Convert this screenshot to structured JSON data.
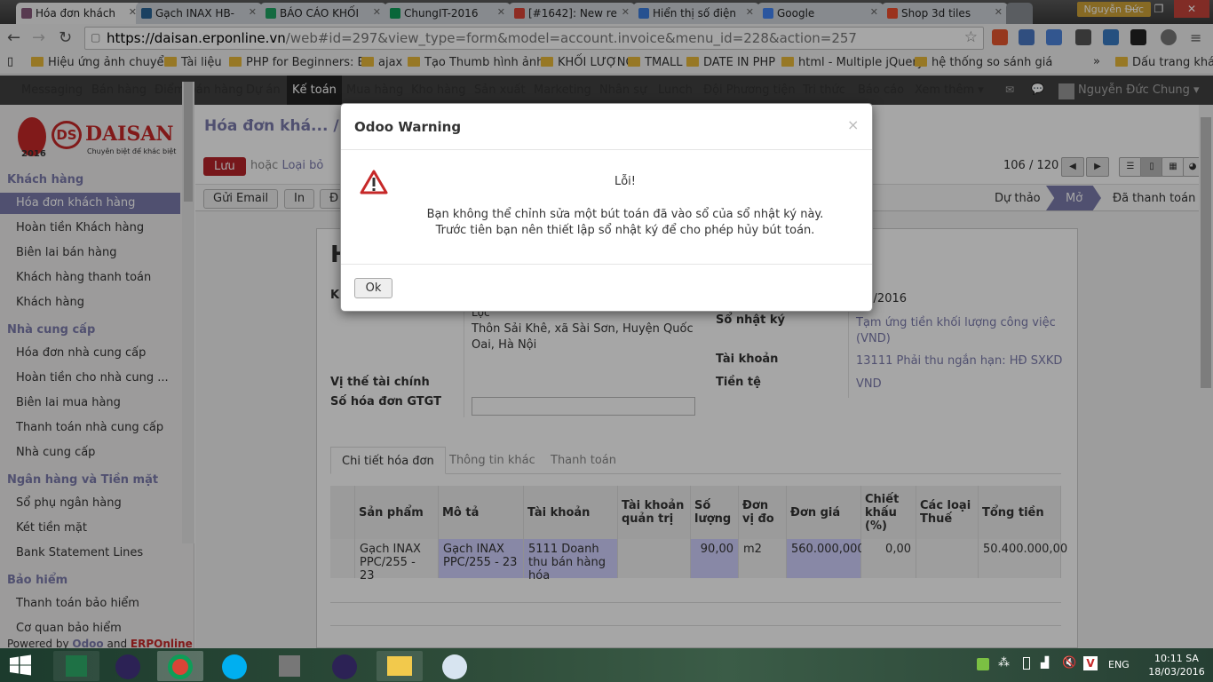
{
  "browser": {
    "tabs": [
      {
        "title": "Hóa đơn khách",
        "active": true,
        "color": "#875a7b"
      },
      {
        "title": "Gạch INAX HB-",
        "color": "#2a6496"
      },
      {
        "title": "BÁO CÁO KHỐI",
        "color": "#1fa463"
      },
      {
        "title": "ChungIT-2016",
        "color": "#0f9d58"
      },
      {
        "title": "[#1642]: New re",
        "color": "#db4437"
      },
      {
        "title": "Hiển thị số điện",
        "color": "#3b7ddd"
      },
      {
        "title": "Google",
        "color": "#4285f4"
      },
      {
        "title": "Shop 3d tiles",
        "color": "#ee4d2d"
      }
    ],
    "user": "Nguyễn Đức",
    "url_host": "https://daisan.erponline.vn",
    "url_rest": "/web#id=297&view_type=form&model=account.invoice&menu_id=228&action=257",
    "bookmarks": [
      "Hiệu ứng ảnh chuyển",
      "Tài liệu",
      "PHP for Beginners: Bu",
      "ajax",
      "Tạo Thumb hình ảnh",
      "KHỐI LƯỢNG",
      "TMALL",
      "DATE IN PHP",
      "html - Multiple jQuery",
      "hệ thống so sánh giá",
      "Dấu trang khác"
    ]
  },
  "topmenu": {
    "items": [
      "Messaging",
      "Bán hàng",
      "Điểm bán hàng",
      "Dự án",
      "Kế toán",
      "Mua hàng",
      "Kho hàng",
      "Sản xuất",
      "Marketing",
      "Nhân sự",
      "Lunch",
      "Đội Phương tiện",
      "Tri thức",
      "Báo cáo",
      "Xem thêm ▾"
    ],
    "active_index": 4,
    "user": "Nguyễn Đức Chung ▾"
  },
  "logo": {
    "name": "DAISAN",
    "slogan": "Chuyên biệt để khác biệt",
    "year": "2016"
  },
  "sidebar": {
    "sections": [
      {
        "title": "Khách hàng",
        "items": [
          "Hóa đơn khách hàng",
          "Hoàn tiền Khách hàng",
          "Biên lai bán hàng",
          "Khách hàng thanh toán",
          "Khách hàng"
        ]
      },
      {
        "title": "Nhà cung cấp",
        "items": [
          "Hóa đơn nhà cung cấp",
          "Hoàn tiền cho nhà cung ...",
          "Biên lai mua hàng",
          "Thanh toán nhà cung cấp",
          "Nhà cung cấp"
        ]
      },
      {
        "title": "Ngân hàng và Tiền mặt",
        "items": [
          "Sổ phụ ngân hàng",
          "Két tiền mặt",
          "Bank Statement Lines"
        ]
      },
      {
        "title": "Bảo hiểm",
        "items": [
          "Thanh toán bảo hiểm",
          "Cơ quan bảo hiểm"
        ]
      }
    ],
    "powered_prefix": "Powered by",
    "powered_odoo": "Odoo",
    "powered_and": "and",
    "powered_erp": "ERPOnline"
  },
  "form": {
    "breadcrumb": "Hóa đơn khá... / P",
    "save": "Lưu",
    "or": "hoặc",
    "discard": "Loại bỏ",
    "buttons": [
      "Gửi Email",
      "In",
      "Đ"
    ],
    "pager": "106 / 120",
    "states": [
      "Dự thảo",
      "Mở",
      "Đã thanh toán"
    ],
    "title_initial": "H",
    "partner_label_initial": "K",
    "partner_line": "Lộc",
    "partner_address": "Thôn Sải Khê, xã Sài Sơn, Huyện Quốc Oai, Hà Nội",
    "fiscal_label": "Vị thế tài chính",
    "vat_label": "Số hóa đơn GTGT",
    "date_value": "03/2016",
    "journal_label": "Sổ nhật ký",
    "journal_value": "Tạm ứng tiền khối lượng công việc (VND)",
    "account_label": "Tài khoản",
    "account_value": "13111 Phải thu ngắn hạn: HĐ SXKD",
    "currency_label": "Tiền tệ",
    "currency_value": "VND",
    "tabs": [
      "Chi tiết hóa đơn",
      "Thông tin khác",
      "Thanh toán"
    ],
    "columns": [
      "Sản phẩm",
      "Mô tả",
      "Tài khoản",
      "Tài khoản quản trị",
      "Số lượng",
      "Đơn vị đo",
      "Đơn giá",
      "Chiết khấu (%)",
      "Các loại Thuế",
      "Tổng tiền"
    ],
    "row": [
      "Gạch INAX PPC/255 - 23",
      "Gạch INAX PPC/255 - 23",
      "5111 Doanh thu bán hàng hóa",
      "",
      "90,00",
      "m2",
      "560.000,000",
      "0,00",
      "",
      "50.400.000,00"
    ]
  },
  "modal": {
    "title": "Odoo Warning",
    "close": "×",
    "heading": "Lỗi!",
    "line1": "Bạn không thể chỉnh sửa một bút toán đã vào sổ của sổ nhật ký này.",
    "line2": "Trước tiên bạn nên thiết lập sổ nhật ký để cho phép hủy bút toán.",
    "ok": "Ok"
  },
  "taskbar": {
    "lang": "ENG",
    "time": "10:11 SA",
    "date": "18/03/2016"
  }
}
